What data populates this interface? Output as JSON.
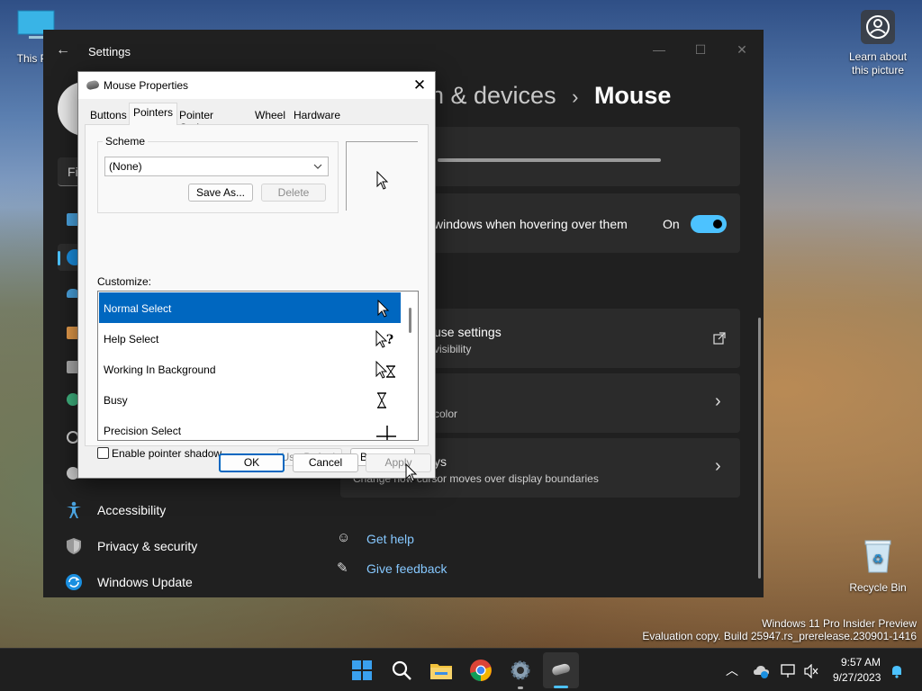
{
  "desktop": {
    "icon_this_pc": "This PC",
    "learn_about": "Learn about this picture",
    "recycle_bin": "Recycle Bin",
    "watermark_line1": "Windows 11 Pro Insider Preview",
    "watermark_line2": "Evaluation copy. Build 25947.rs_prerelease.230901-1416"
  },
  "settings": {
    "title": "Settings",
    "breadcrumb_parent": "h & devices",
    "breadcrumb_current": "Mouse",
    "search_fragment": "Fi",
    "sidebar": [
      {
        "label": "Accessibility",
        "icon": "accessibility-icon"
      },
      {
        "label": "Privacy & security",
        "icon": "shield-icon"
      },
      {
        "label": "Windows Update",
        "icon": "update-icon"
      }
    ],
    "scroll_inactive_label": "windows when hovering over them",
    "toggle_state": "On",
    "additional_settings": "use settings",
    "additional_sub": "visibility",
    "pointer_color_sub": "color",
    "multi_display_title": "ys",
    "multi_display_sub": "Change how cursor moves over display boundaries",
    "get_help": "Get help",
    "give_feedback": "Give feedback"
  },
  "dialog": {
    "title": "Mouse Properties",
    "tabs": [
      "Buttons",
      "Pointers",
      "Pointer Options",
      "Wheel",
      "Hardware"
    ],
    "active_tab": "Pointers",
    "scheme_label": "Scheme",
    "scheme_value": "(None)",
    "save_as": "Save As...",
    "delete": "Delete",
    "customize_label": "Customize:",
    "pointers": [
      {
        "label": "Normal Select",
        "icon": "arrow-cursor-icon"
      },
      {
        "label": "Help Select",
        "icon": "help-cursor-icon"
      },
      {
        "label": "Working In Background",
        "icon": "working-cursor-icon"
      },
      {
        "label": "Busy",
        "icon": "hourglass-icon"
      },
      {
        "label": "Precision Select",
        "icon": "crosshair-icon"
      }
    ],
    "shadow_label": "Enable pointer shadow",
    "use_default": "Use Default",
    "browse": "Browse...",
    "ok": "OK",
    "cancel": "Cancel",
    "apply": "Apply"
  },
  "taskbar": {
    "time": "9:57 AM",
    "date": "9/27/2023"
  },
  "colors": {
    "accent": "#0067c0",
    "toggle": "#4cc2ff"
  }
}
